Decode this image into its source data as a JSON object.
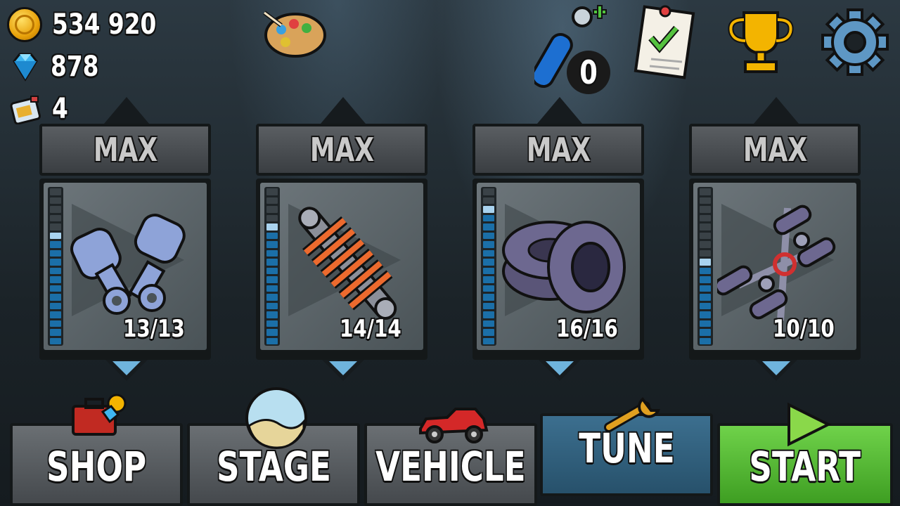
{
  "currency": {
    "coins": "534 920",
    "gems": "878",
    "fuel_cans": "4"
  },
  "top_bar": {
    "boosts_count": "0",
    "icons": [
      "paint-palette-icon",
      "fuel-boost-icon",
      "missions-checklist-icon",
      "trophy-icon",
      "settings-gear-icon"
    ]
  },
  "upgrades": [
    {
      "name": "engine",
      "status": "MAX",
      "level": "13/13",
      "icon": "engine-pistons-icon",
      "filled": 13,
      "total": 18
    },
    {
      "name": "suspension",
      "status": "MAX",
      "level": "14/14",
      "icon": "suspension-spring-icon",
      "filled": 14,
      "total": 18
    },
    {
      "name": "tires",
      "status": "MAX",
      "level": "16/16",
      "icon": "tires-icon",
      "filled": 16,
      "total": 18
    },
    {
      "name": "drivetrain",
      "status": "MAX",
      "level": "10/10",
      "icon": "drivetrain-axles-icon",
      "filled": 10,
      "total": 18
    }
  ],
  "nav": {
    "shop": "SHOP",
    "stage": "STAGE",
    "vehicle": "VEHICLE",
    "tune": "TUNE",
    "start": "START"
  },
  "colors": {
    "bar_fill": "#1b6fa8",
    "tune_active": "#2f6281",
    "start_green": "#4fb12c"
  }
}
